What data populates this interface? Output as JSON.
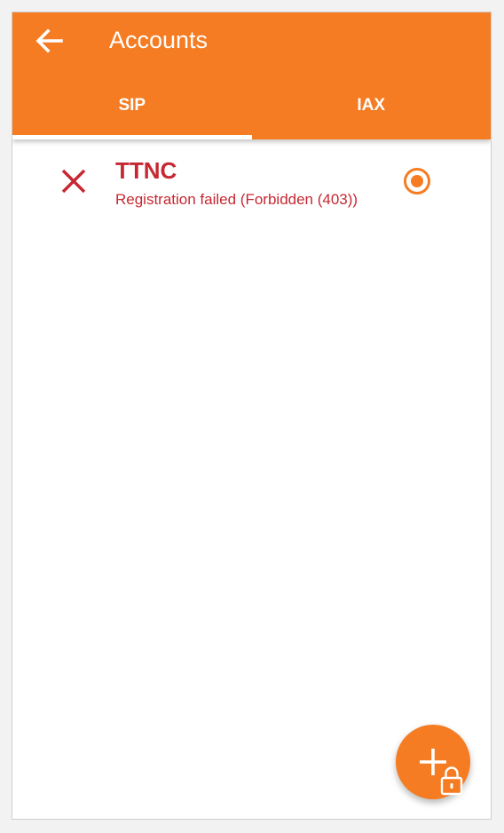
{
  "appbar": {
    "title": "Accounts",
    "back_icon": "arrow-back-icon"
  },
  "tabs": [
    {
      "label": "SIP",
      "selected": true
    },
    {
      "label": "IAX",
      "selected": false
    }
  ],
  "accounts": [
    {
      "name": "TTNC",
      "status": "Registration failed (Forbidden (403))",
      "status_icon": "close-icon",
      "default_selected": true
    }
  ],
  "fab": {
    "icons": [
      "plus-icon",
      "lock-icon"
    ]
  },
  "colors": {
    "accent": "#f57c22",
    "error": "#c62832",
    "background": "#ffffff"
  }
}
